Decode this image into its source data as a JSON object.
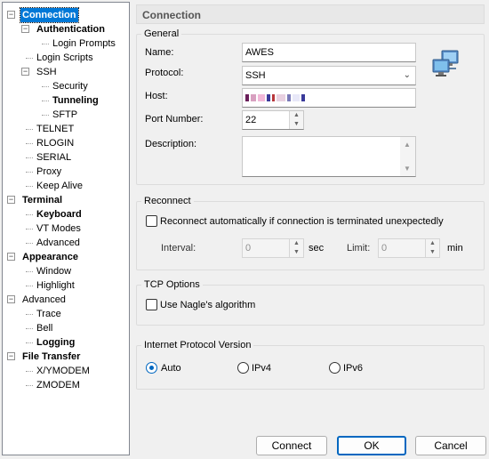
{
  "tree": {
    "items": [
      {
        "label": "Connection",
        "bold": true,
        "selected": true,
        "level": 0,
        "expander": "−"
      },
      {
        "label": "Authentication",
        "bold": true,
        "level": 1,
        "expander": "−"
      },
      {
        "label": "Login Prompts",
        "level": 2
      },
      {
        "label": "Login Scripts",
        "level": 1
      },
      {
        "label": "SSH",
        "level": 1,
        "expander": "−"
      },
      {
        "label": "Security",
        "level": 2
      },
      {
        "label": "Tunneling",
        "bold": true,
        "level": 2
      },
      {
        "label": "SFTP",
        "level": 2
      },
      {
        "label": "TELNET",
        "level": 1
      },
      {
        "label": "RLOGIN",
        "level": 1
      },
      {
        "label": "SERIAL",
        "level": 1
      },
      {
        "label": "Proxy",
        "level": 1
      },
      {
        "label": "Keep Alive",
        "level": 1
      },
      {
        "label": "Terminal",
        "bold": true,
        "level": 0,
        "expander": "−"
      },
      {
        "label": "Keyboard",
        "bold": true,
        "level": 1
      },
      {
        "label": "VT Modes",
        "level": 1
      },
      {
        "label": "Advanced",
        "level": 1
      },
      {
        "label": "Appearance",
        "bold": true,
        "level": 0,
        "expander": "−"
      },
      {
        "label": "Window",
        "level": 1
      },
      {
        "label": "Highlight",
        "level": 1
      },
      {
        "label": "Advanced",
        "level": 0,
        "expander": "−"
      },
      {
        "label": "Trace",
        "level": 1
      },
      {
        "label": "Bell",
        "level": 1
      },
      {
        "label": "Logging",
        "bold": true,
        "level": 1
      },
      {
        "label": "File Transfer",
        "bold": true,
        "level": 0,
        "expander": "−"
      },
      {
        "label": "X/YMODEM",
        "level": 1
      },
      {
        "label": "ZMODEM",
        "level": 1
      }
    ]
  },
  "panel_title": "Connection",
  "general": {
    "title": "General",
    "name_label": "Name:",
    "name_value": "AWES",
    "protocol_label": "Protocol:",
    "protocol_value": "SSH",
    "host_label": "Host:",
    "port_label": "Port Number:",
    "port_value": "22",
    "description_label": "Description:",
    "description_value": "",
    "computer_icon": "computers-network-icon"
  },
  "reconnect": {
    "title": "Reconnect",
    "checkbox_label": "Reconnect automatically if connection is terminated unexpectedly",
    "interval_label": "Interval:",
    "interval_value": "0",
    "interval_unit": "sec",
    "limit_label": "Limit:",
    "limit_value": "0",
    "limit_unit": "min"
  },
  "tcp": {
    "title": "TCP Options",
    "nagle_label": "Use Nagle's algorithm"
  },
  "ip_version": {
    "title": "Internet Protocol Version",
    "options": [
      "Auto",
      "IPv4",
      "IPv6"
    ],
    "selected": "Auto"
  },
  "buttons": {
    "connect": "Connect",
    "ok": "OK",
    "cancel": "Cancel"
  },
  "colors": {
    "accent": "#0067c0",
    "selection": "#0078d7"
  }
}
